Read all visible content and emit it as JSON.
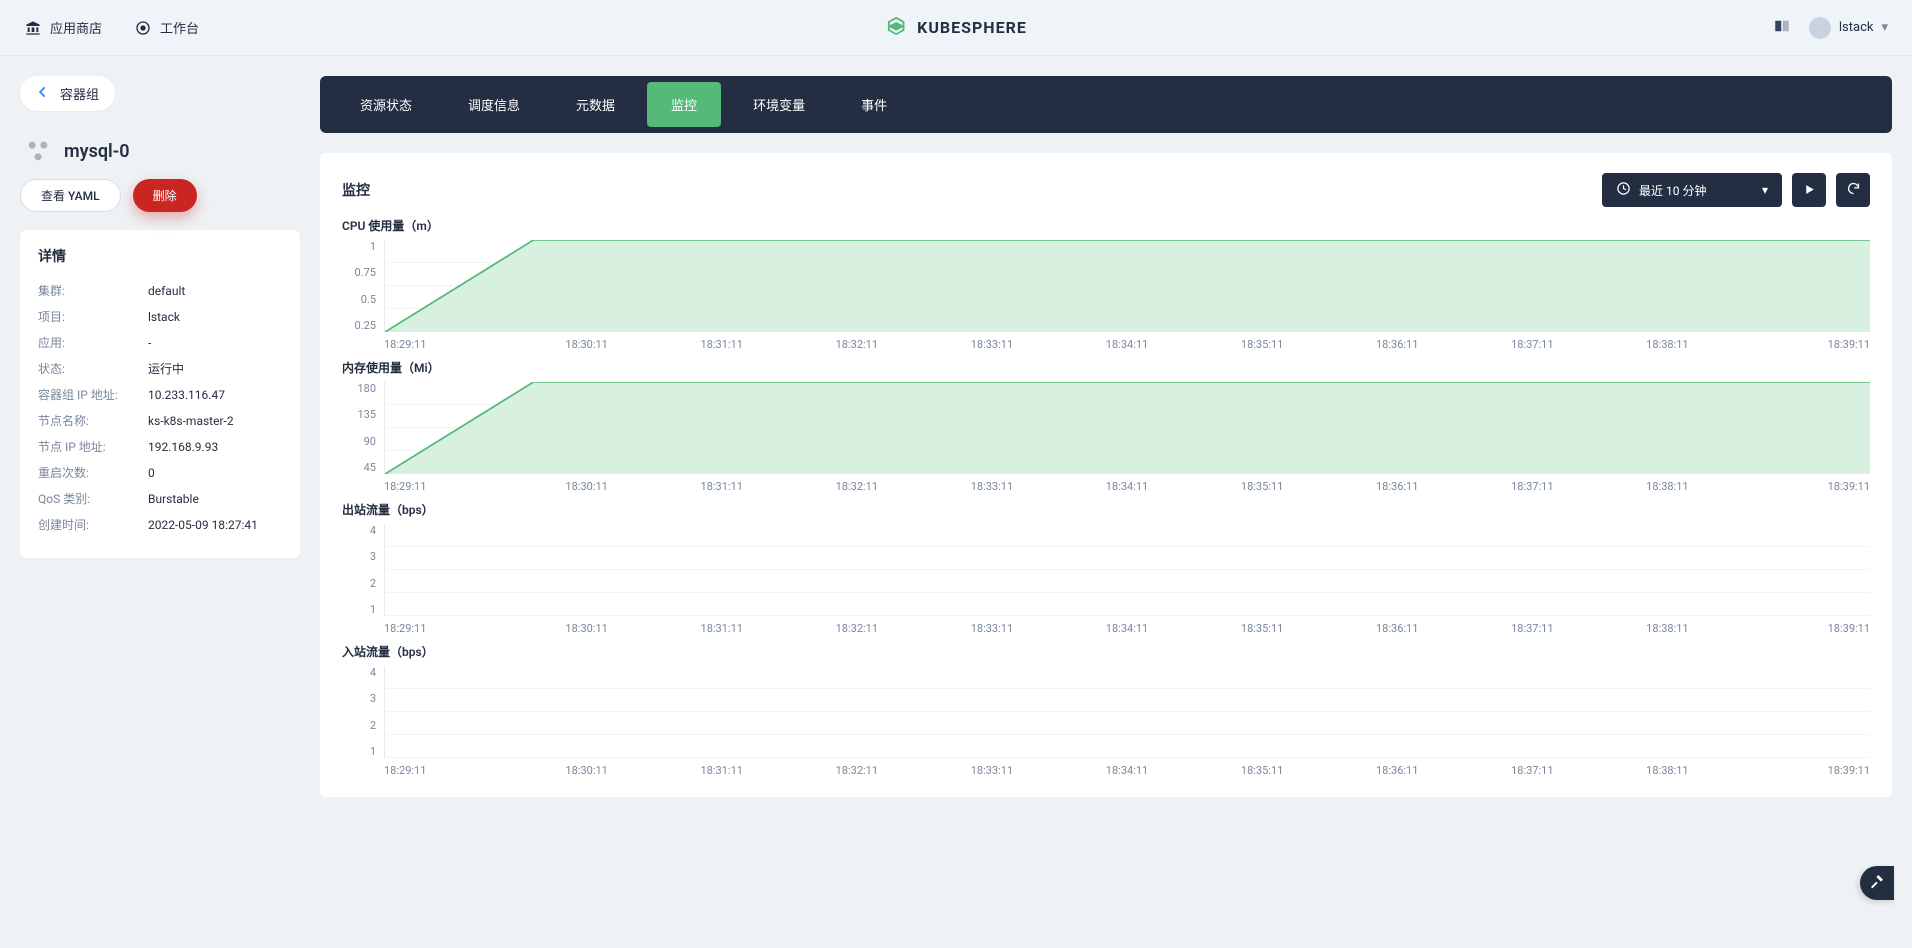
{
  "topbar": {
    "app_store": "应用商店",
    "workbench": "工作台",
    "brand": "KUBESPHERE",
    "user": "lstack"
  },
  "breadcrumb": {
    "back": "容器组"
  },
  "pod": {
    "name": "mysql-0"
  },
  "buttons": {
    "yaml": "查看 YAML",
    "delete": "删除"
  },
  "details": {
    "title": "详情",
    "rows": [
      {
        "k": "集群:",
        "v": "default"
      },
      {
        "k": "项目:",
        "v": "lstack"
      },
      {
        "k": "应用:",
        "v": "-"
      },
      {
        "k": "状态:",
        "v": "运行中"
      },
      {
        "k": "容器组 IP 地址:",
        "v": "10.233.116.47"
      },
      {
        "k": "节点名称:",
        "v": "ks-k8s-master-2"
      },
      {
        "k": "节点 IP 地址:",
        "v": "192.168.9.93"
      },
      {
        "k": "重启次数:",
        "v": "0"
      },
      {
        "k": "QoS 类别:",
        "v": "Burstable"
      },
      {
        "k": "创建时间:",
        "v": "2022-05-09 18:27:41"
      }
    ]
  },
  "tabs": [
    "资源状态",
    "调度信息",
    "元数据",
    "监控",
    "环境变量",
    "事件"
  ],
  "active_tab": "监控",
  "panel": {
    "title": "监控",
    "time_range": "最近 10 分钟"
  },
  "x_ticks": [
    "18:29:11",
    "18:30:11",
    "18:31:11",
    "18:32:11",
    "18:33:11",
    "18:34:11",
    "18:35:11",
    "18:36:11",
    "18:37:11",
    "18:38:11",
    "18:39:11"
  ],
  "chart_data": [
    {
      "type": "area",
      "title": "CPU 使用量（m）",
      "y_ticks": [
        "1",
        "0.75",
        "0.5",
        "0.25"
      ],
      "ylim": [
        0,
        1
      ],
      "x": [
        "18:29:11",
        "18:30:11",
        "18:31:11",
        "18:32:11",
        "18:33:11",
        "18:34:11",
        "18:35:11",
        "18:36:11",
        "18:37:11",
        "18:38:11",
        "18:39:11"
      ],
      "values": [
        0,
        1,
        1,
        1,
        1,
        1,
        1,
        1,
        1,
        1,
        1
      ]
    },
    {
      "type": "area",
      "title": "内存使用量（Mi）",
      "y_ticks": [
        "180",
        "135",
        "90",
        "45"
      ],
      "ylim": [
        0,
        180
      ],
      "x": [
        "18:29:11",
        "18:30:11",
        "18:31:11",
        "18:32:11",
        "18:33:11",
        "18:34:11",
        "18:35:11",
        "18:36:11",
        "18:37:11",
        "18:38:11",
        "18:39:11"
      ],
      "values": [
        0,
        180,
        180,
        180,
        180,
        180,
        180,
        180,
        180,
        180,
        180
      ]
    },
    {
      "type": "area",
      "title": "出站流量（bps）",
      "y_ticks": [
        "4",
        "3",
        "2",
        "1"
      ],
      "ylim": [
        0,
        4
      ],
      "x": [
        "18:29:11",
        "18:30:11",
        "18:31:11",
        "18:32:11",
        "18:33:11",
        "18:34:11",
        "18:35:11",
        "18:36:11",
        "18:37:11",
        "18:38:11",
        "18:39:11"
      ],
      "values": [
        0,
        0,
        0,
        0,
        0,
        0,
        0,
        0,
        0,
        0,
        0
      ]
    },
    {
      "type": "area",
      "title": "入站流量（bps）",
      "y_ticks": [
        "4",
        "3",
        "2",
        "1"
      ],
      "ylim": [
        0,
        4
      ],
      "x": [
        "18:29:11",
        "18:30:11",
        "18:31:11",
        "18:32:11",
        "18:33:11",
        "18:34:11",
        "18:35:11",
        "18:36:11",
        "18:37:11",
        "18:38:11",
        "18:39:11"
      ],
      "values": [
        0,
        0,
        0,
        0,
        0,
        0,
        0,
        0,
        0,
        0,
        0
      ]
    }
  ]
}
